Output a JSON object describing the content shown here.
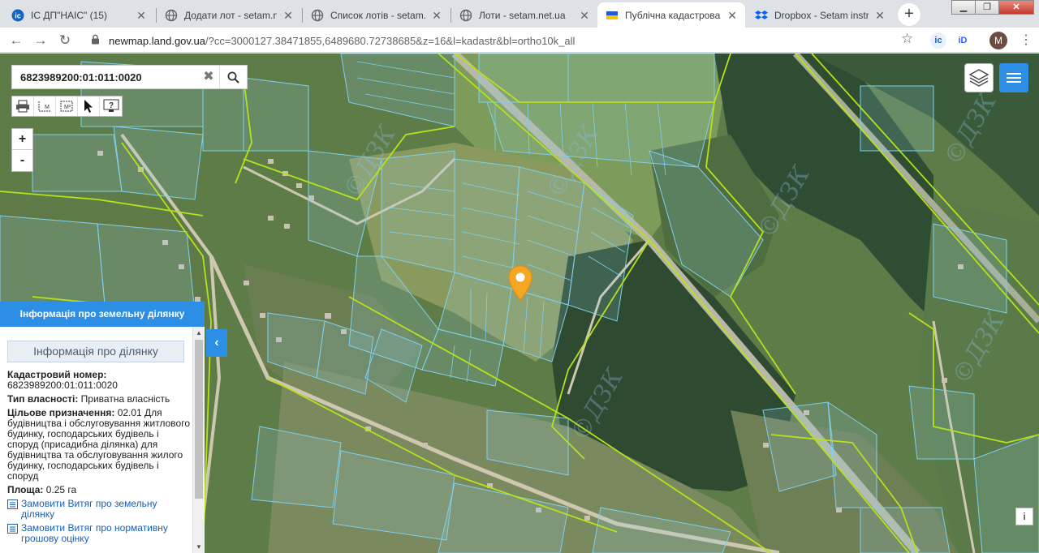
{
  "browser": {
    "tabs": [
      {
        "title": "ІС ДП\"НАІС\" (15)",
        "icon": "nais-logo-icon",
        "active": false
      },
      {
        "title": "Додати лот - setam.net.ua",
        "icon": "globe-icon",
        "active": false
      },
      {
        "title": "Список лотів - setam.net.ua",
        "icon": "globe-icon",
        "active": false
      },
      {
        "title": "Лоти - setam.net.ua",
        "icon": "globe-icon",
        "active": false
      },
      {
        "title": "Публічна кадастрова карта",
        "icon": "ukraine-trident-icon",
        "active": true
      },
      {
        "title": "Dropbox - Setam instructions",
        "icon": "dropbox-icon",
        "active": false
      }
    ],
    "url_host": "newmap.land.gov.ua",
    "url_path": "/?cc=3000127.38471855,6489680.72738685&z=16&l=kadastr&bl=ortho10k_all",
    "avatar_letter": "M",
    "colors": {
      "accent": "#1a73e8",
      "tabbar": "#dee1e6"
    }
  },
  "map": {
    "search_value": "6823989200:01:011:0020",
    "zoom_in_label": "+",
    "zoom_out_label": "-",
    "info_label": "i",
    "colors": {
      "parcel": "#7fd0ec",
      "boundary": "#b6e11b",
      "marker": "#f5a623",
      "ui_blue": "#2d8ee6"
    }
  },
  "panel": {
    "header": "Інформація про земельну ділянку",
    "subheader": "Інформація про ділянку",
    "cadastral_label": "Кадастровий номер:",
    "cadastral_value": "6823989200:01:011:0020",
    "ownership_label": "Тип власності:",
    "ownership_value": "Приватна власність",
    "purpose_label": "Цільове призначення:",
    "purpose_value": "02.01 Для будівництва і обслуговування житлового будинку, господарських будівель і споруд (присадибна ділянка) для будівництва та обслуговування жилого будинку, господарських будівель і споруд",
    "area_label": "Площа:",
    "area_value": "0.25 га",
    "link1": "Замовити Витяг про земельну ділянку",
    "link2": "Замовити Витяг про нормативну грошову оцінку"
  }
}
